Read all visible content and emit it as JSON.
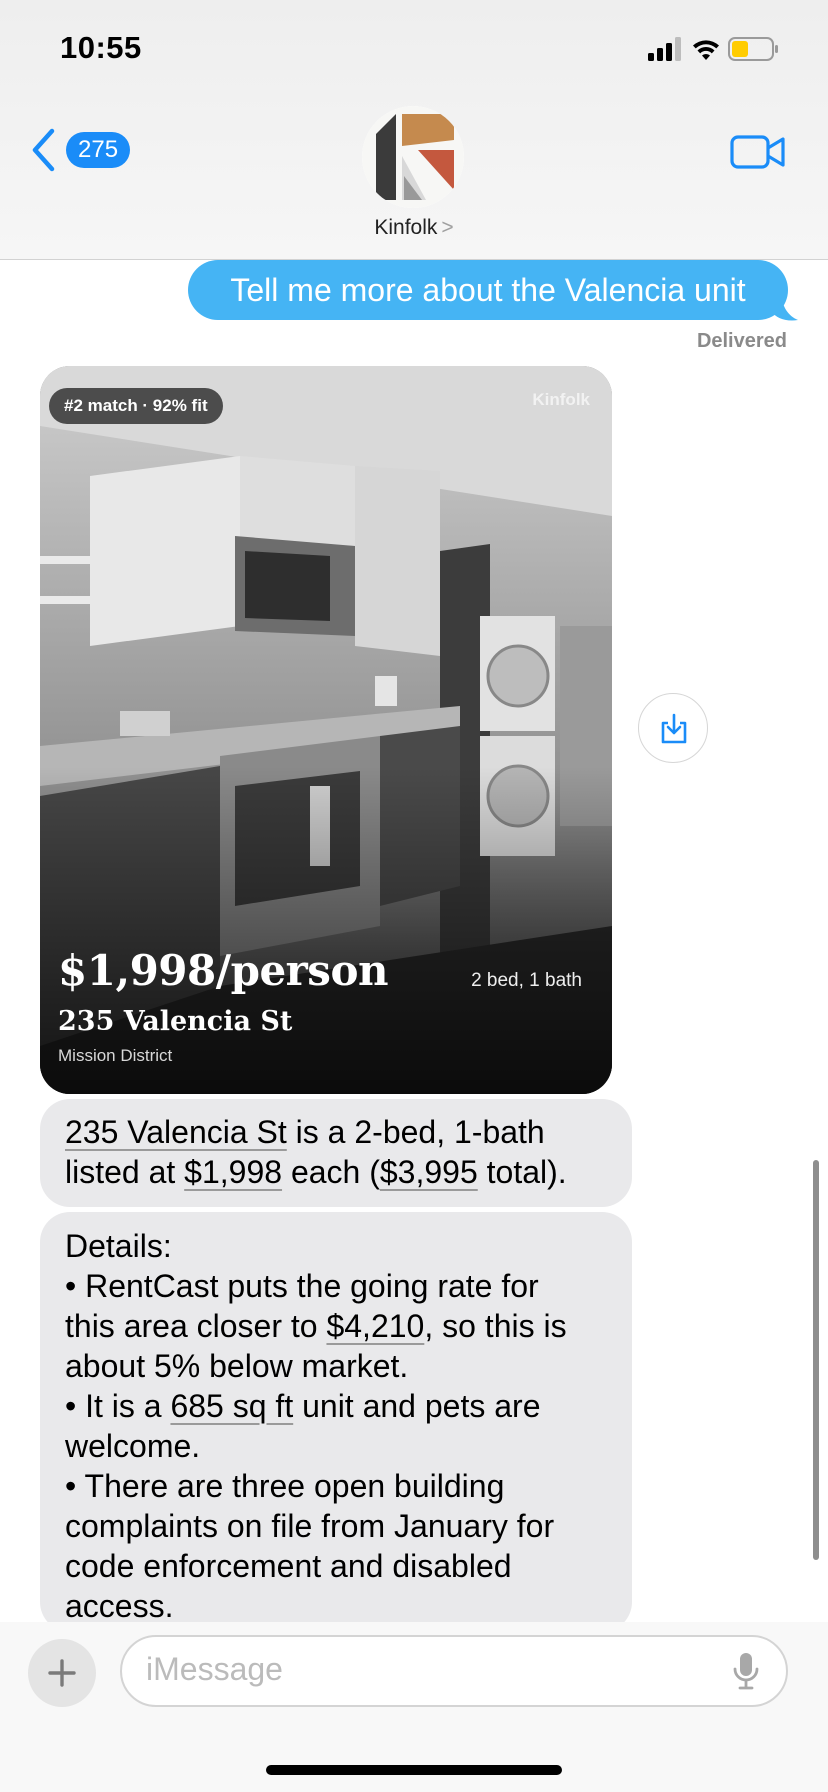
{
  "status_bar": {
    "time": "10:55",
    "icons": [
      "cellular-signal-icon",
      "wifi-icon",
      "battery-icon"
    ],
    "battery_color": "#ffcc00"
  },
  "header": {
    "back_icon": "chevron-left-icon",
    "unread_count": "275",
    "contact_name": "Kinfolk",
    "contact_chevron": ">",
    "video_icon": "video-camera-icon",
    "accent": "#1a8cf8"
  },
  "messages": {
    "sent": {
      "text": "Tell me more about the Valencia unit",
      "status": "Delivered",
      "color": "#45b4f4"
    },
    "listing_card": {
      "badge": "#2 match · 92% fit",
      "brand": "Kinfolk",
      "price": "$1,998/person",
      "beds_baths": "2 bed, 1 bath",
      "address": "235 Valencia St",
      "neighborhood": "Mission District",
      "save_icon": "download-tray-icon"
    },
    "reply_1": {
      "address_link": "235 Valencia St",
      "text_a": " is a 2-bed, 1-bath",
      "text_b": "listed at ",
      "price_link": "$1,998",
      "text_c": " each (",
      "total_link": "$3,995",
      "text_d": " total)."
    },
    "reply_2": {
      "heading": "Details:",
      "b1_a": "• RentCast puts the going rate for",
      "b1_b": "this area closer to ",
      "b1_link": "$4,210",
      "b1_c": ", so this is",
      "b1_d": "about 5% below market.",
      "b2_a": "• It is a ",
      "b2_link": "685 sq ft",
      "b2_b": " unit and pets are",
      "b2_c": "welcome.",
      "b3_a": "• There are three open building",
      "b3_b": "complaints on file from January for",
      "b3_c": "code enforcement and disabled",
      "b3_d": "access."
    }
  },
  "composer": {
    "plus_icon": "plus-icon",
    "placeholder": "iMessage",
    "mic_icon": "microphone-icon"
  }
}
